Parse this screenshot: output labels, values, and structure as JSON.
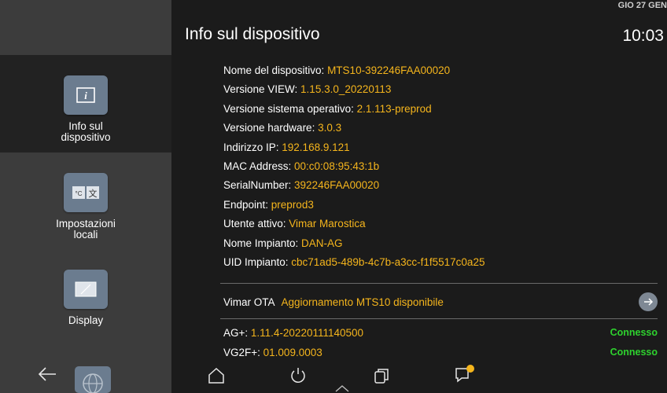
{
  "sidebar": {
    "items": [
      {
        "label": "Info sul\ndispositivo",
        "icon": "info-icon"
      },
      {
        "label": "Impostazioni\nlocali",
        "icon": "locale-settings-icon"
      },
      {
        "label": "Display",
        "icon": "display-icon"
      }
    ]
  },
  "header": {
    "title": "Info sul dispositivo",
    "date": "GIO 27 GEN",
    "time": "10:03"
  },
  "info": [
    {
      "label": "Nome del dispositivo: ",
      "value": "MTS10-392246FAA00020"
    },
    {
      "label": "Versione VIEW: ",
      "value": "1.15.3.0_20220113"
    },
    {
      "label": "Versione sistema operativo: ",
      "value": "2.1.113-preprod"
    },
    {
      "label": "Versione hardware: ",
      "value": "3.0.3"
    },
    {
      "label": "Indirizzo IP: ",
      "value": "192.168.9.121"
    },
    {
      "label": "MAC Address: ",
      "value": "00:c0:08:95:43:1b"
    },
    {
      "label": "SerialNumber: ",
      "value": "392246FAA00020"
    },
    {
      "label": "Endpoint: ",
      "value": "preprod3"
    },
    {
      "label": "Utente attivo: ",
      "value": "Vimar Marostica"
    },
    {
      "label": "Nome Impianto: ",
      "value": "DAN-AG"
    },
    {
      "label": "UID Impianto: ",
      "value": "cbc71ad5-489b-4c7b-a3cc-f1f5517c0a25"
    }
  ],
  "ota": {
    "label": "Vimar OTA",
    "value": "Aggiornamento MTS10 disponibile"
  },
  "connections": [
    {
      "label": "AG+: ",
      "value": "1.11.4-20220111140500",
      "status": "Connesso"
    },
    {
      "label": "VG2F+: ",
      "value": "01.009.0003",
      "status": "Connesso"
    }
  ],
  "colors": {
    "accent": "#f5b51c",
    "connected": "#2ed22e",
    "sidebar": "#3c3c3c",
    "active": "#222222"
  }
}
